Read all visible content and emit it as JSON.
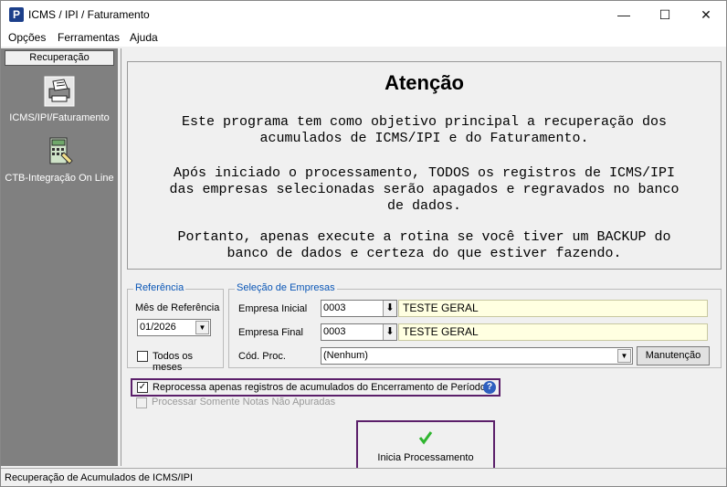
{
  "window": {
    "title": "ICMS / IPI / Faturamento",
    "app_icon": "P",
    "minimize": "—",
    "maximize": "☐",
    "close": "✕"
  },
  "menu": [
    "Opções",
    "Ferramentas",
    "Ajuda"
  ],
  "sidebar": {
    "header": "Recuperação",
    "items": [
      {
        "label": "ICMS/IPI/Faturamento",
        "icon": "printer-icon"
      },
      {
        "label": "CTB-Integração On Line",
        "icon": "calculator-icon"
      }
    ]
  },
  "attention": {
    "title": "Atenção",
    "p1": "Este programa tem como objetivo principal a recuperação dos\nacumulados de ICMS/IPI e do Faturamento.",
    "p2": "Após iniciado o processamento, TODOS os registros de ICMS/IPI\ndas empresas selecionadas serão apagados e regravados no banco\nde dados.",
    "p3": "Portanto, apenas execute a rotina se você tiver um BACKUP do\nbanco de dados e certeza do que estiver fazendo."
  },
  "referencia": {
    "legend": "Referência",
    "mes_label": "Mês de Referência",
    "mes_value": "01/2026",
    "todos_label": "Todos os meses"
  },
  "empresas": {
    "legend": "Seleção de Empresas",
    "inicial_label": "Empresa Inicial",
    "inicial_code": "0003",
    "inicial_name": "TESTE GERAL",
    "final_label": "Empresa Final",
    "final_code": "0003",
    "final_name": "TESTE GERAL",
    "proc_label": "Cód. Proc.",
    "proc_value": "(Nenhum)",
    "manutencao": "Manutenção"
  },
  "options": {
    "reprocessa": "Reprocessa apenas registros de acumulados do Encerramento de Período",
    "somente_notas": "Processar Somente Notas Não Apuradas"
  },
  "start_button": "Inicia Processamento",
  "status": "Recuperação de Acumulados de ICMS/IPI",
  "colors": {
    "accent": "#5b1f6a",
    "sidebar": "#808080",
    "legend": "#0a56b6",
    "highlight": "#ffffe1"
  }
}
